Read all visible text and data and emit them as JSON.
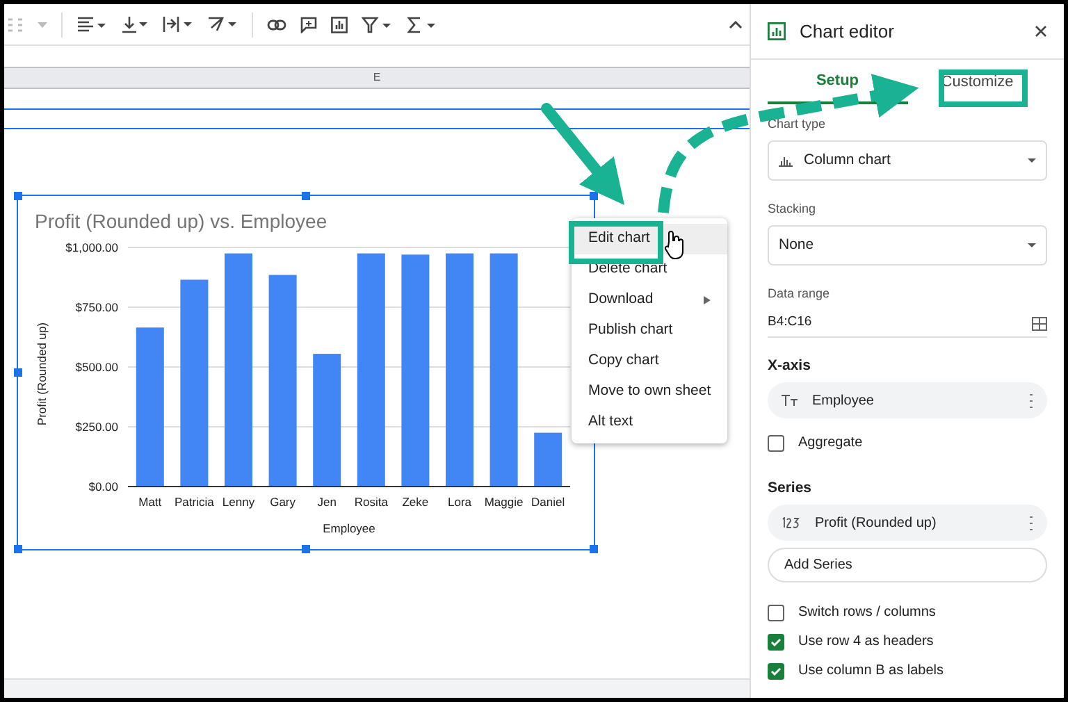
{
  "column_header": {
    "label": "E"
  },
  "chart": {
    "chart_data": {
      "type": "bar",
      "title": "Profit (Rounded up) vs. Employee",
      "xlabel": "Employee",
      "ylabel": "Profit (Rounded up)",
      "categories": [
        "Matt",
        "Patricia",
        "Lenny",
        "Gary",
        "Jen",
        "Rosita",
        "Zeke",
        "Lora",
        "Maggie",
        "Daniel"
      ],
      "series": [
        {
          "color": "#4285f4",
          "values": [
            665,
            865,
            975,
            885,
            555,
            975,
            970,
            975,
            975,
            225
          ]
        }
      ],
      "grid": true,
      "ylim": [
        0,
        1000
      ],
      "yticks": [
        {
          "value": 0,
          "label": "$0.00"
        },
        {
          "value": 250,
          "label": "$250.00"
        },
        {
          "value": 500,
          "label": "$500.00"
        },
        {
          "value": 750,
          "label": "$750.00"
        },
        {
          "value": 1000,
          "label": "$1,000.00"
        }
      ]
    }
  },
  "context_menu": {
    "items": [
      {
        "label": "Edit chart",
        "selected": true,
        "has_submenu": false
      },
      {
        "label": "Delete chart",
        "selected": false,
        "has_submenu": false
      },
      {
        "label": "Download",
        "selected": false,
        "has_submenu": true
      },
      {
        "label": "Publish chart",
        "selected": false,
        "has_submenu": false
      },
      {
        "label": "Copy chart",
        "selected": false,
        "has_submenu": false
      },
      {
        "label": "Move to own sheet",
        "selected": false,
        "has_submenu": false
      },
      {
        "label": "Alt text",
        "selected": false,
        "has_submenu": false
      }
    ]
  },
  "chart_editor": {
    "title": "Chart editor",
    "tabs": [
      {
        "label": "Setup",
        "selected": true
      },
      {
        "label": "Customize",
        "selected": false
      }
    ],
    "chart_type": {
      "label": "Chart type",
      "value": "Column chart"
    },
    "stacking": {
      "label": "Stacking",
      "value": "None"
    },
    "data_range": {
      "label": "Data range",
      "value": "B4:C16"
    },
    "x_axis": {
      "heading": "X-axis",
      "chip": "Employee"
    },
    "aggregate": {
      "label": "Aggregate",
      "checked": false
    },
    "series": {
      "heading": "Series",
      "chip": "Profit (Rounded up)",
      "add_button": "Add Series"
    },
    "options": [
      {
        "label": "Switch rows / columns",
        "checked": false
      },
      {
        "label": "Use row 4 as headers",
        "checked": true
      },
      {
        "label": "Use column B as labels",
        "checked": true
      }
    ]
  }
}
